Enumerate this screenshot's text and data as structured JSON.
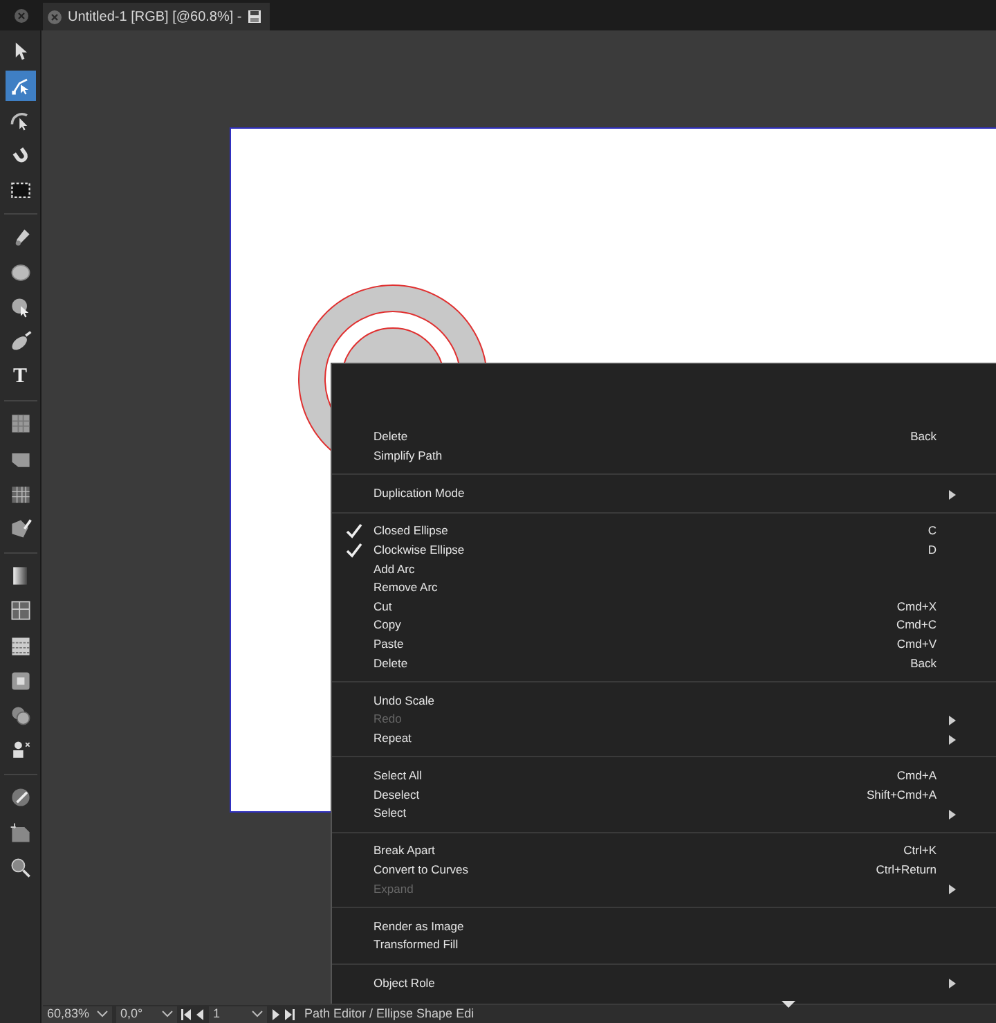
{
  "tabs": [
    {
      "label": "Untitled-1 [RGB] [@60.8%] -",
      "selected": true
    }
  ],
  "tools": [
    {
      "selected": false
    },
    {
      "selected": true
    },
    {
      "selected": false
    },
    {
      "selected": false
    },
    {
      "selected": false
    },
    {
      "selected": false
    },
    {
      "selected": false
    },
    {
      "selected": false
    },
    {
      "selected": false
    },
    {
      "selected": false,
      "kind": "text",
      "label": "T"
    },
    {
      "selected": false
    },
    {
      "selected": false
    },
    {
      "selected": false
    },
    {
      "selected": false
    },
    {
      "selected": false
    },
    {
      "selected": false
    },
    {
      "selected": false
    },
    {
      "selected": false
    },
    {
      "selected": false
    },
    {
      "selected": false
    },
    {
      "selected": false
    },
    {
      "selected": false
    },
    {
      "selected": false
    }
  ],
  "context_menu": {
    "groups": [
      [
        {
          "label": "Delete",
          "shortcut": "Back",
          "checked": false,
          "disabled": false,
          "submenu": false
        },
        {
          "label": "Simplify Path",
          "checked": false,
          "disabled": false,
          "submenu": false
        }
      ],
      [
        {
          "label": "Duplication Mode",
          "checked": false,
          "disabled": false,
          "submenu": true
        }
      ],
      [
        {
          "label": "Closed Ellipse",
          "shortcut": "C",
          "checked": true,
          "disabled": false,
          "submenu": false
        },
        {
          "label": "Clockwise Ellipse",
          "shortcut": "D",
          "checked": true,
          "disabled": false,
          "submenu": false
        },
        {
          "label": "Add Arc",
          "checked": false,
          "disabled": false,
          "submenu": false
        },
        {
          "label": "Remove Arc",
          "checked": false,
          "disabled": false,
          "submenu": false
        },
        {
          "label": "Cut",
          "shortcut": "Cmd+X",
          "checked": false,
          "disabled": false,
          "submenu": false
        },
        {
          "label": "Copy",
          "shortcut": "Cmd+C",
          "checked": false,
          "disabled": false,
          "submenu": false
        },
        {
          "label": "Paste",
          "shortcut": "Cmd+V",
          "checked": false,
          "disabled": false,
          "submenu": false
        },
        {
          "label": "Delete",
          "shortcut": "Back",
          "checked": false,
          "disabled": false,
          "submenu": false
        }
      ],
      [
        {
          "label": "Undo Scale",
          "checked": false,
          "disabled": false,
          "submenu": false
        },
        {
          "label": "Redo",
          "checked": false,
          "disabled": true,
          "submenu": true
        },
        {
          "label": "Repeat",
          "checked": false,
          "disabled": false,
          "submenu": true
        }
      ],
      [
        {
          "label": "Select All",
          "shortcut": "Cmd+A",
          "checked": false,
          "disabled": false,
          "submenu": false
        },
        {
          "label": "Deselect",
          "shortcut": "Shift+Cmd+A",
          "checked": false,
          "disabled": false,
          "submenu": false
        },
        {
          "label": "Select",
          "checked": false,
          "disabled": false,
          "submenu": true
        }
      ],
      [
        {
          "label": "Break Apart",
          "shortcut": "Ctrl+K",
          "checked": false,
          "disabled": false,
          "submenu": false
        },
        {
          "label": "Convert to Curves",
          "shortcut": "Ctrl+Return",
          "checked": false,
          "disabled": false,
          "submenu": false
        },
        {
          "label": "Expand",
          "checked": false,
          "disabled": true,
          "submenu": true
        }
      ],
      [
        {
          "label": "Render as Image",
          "checked": false,
          "disabled": false,
          "submenu": false
        },
        {
          "label": "Transformed Fill",
          "checked": false,
          "disabled": false,
          "submenu": false
        }
      ],
      [
        {
          "label": "Object Role",
          "checked": false,
          "disabled": false,
          "submenu": true
        }
      ]
    ]
  },
  "status_bar": {
    "zoom": "60,83%",
    "rotation": "0,0°",
    "page": "1",
    "mode": "Path Editor / Ellipse Shape Edi"
  }
}
